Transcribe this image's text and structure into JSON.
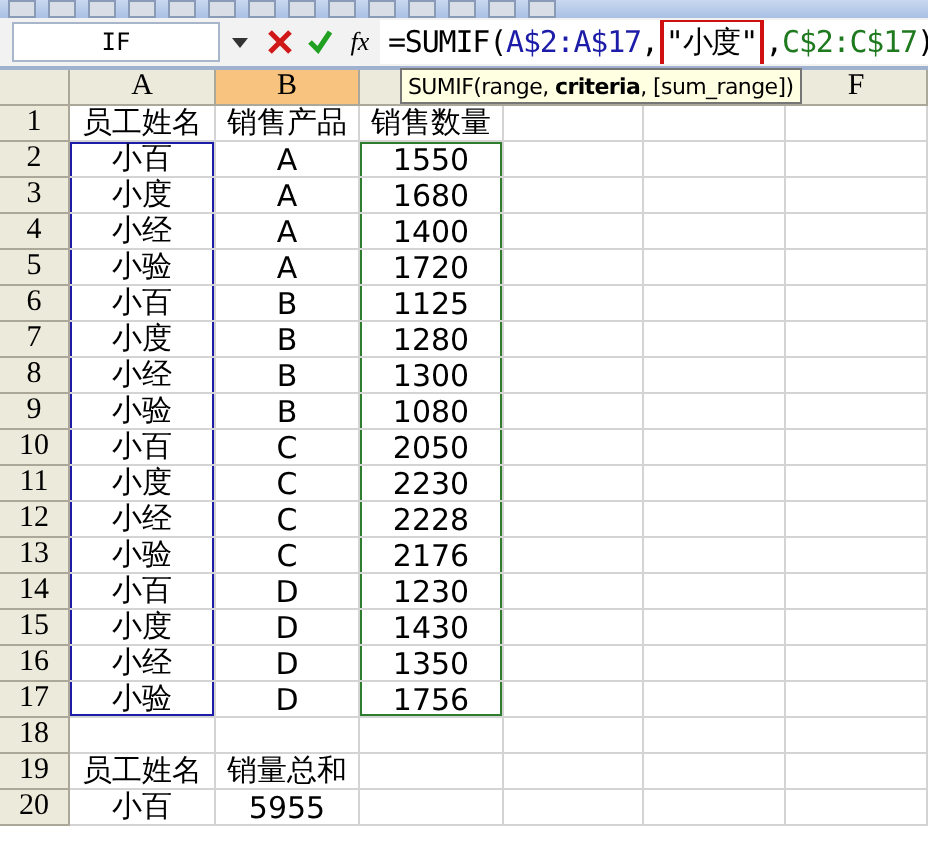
{
  "name_box": "IF",
  "formula_buttons": {
    "function_label": "fx"
  },
  "formula_parts": [
    {
      "text": "=SUMIF(",
      "kind": "plain"
    },
    {
      "text": "A$2:A$17",
      "kind": "ref",
      "color": "#1c1ca8"
    },
    {
      "text": ",",
      "kind": "plain"
    },
    {
      "text": "\"小度\"",
      "kind": "highlight"
    },
    {
      "text": ",",
      "kind": "plain"
    },
    {
      "text": "C$2:C$17",
      "kind": "ref",
      "color": "#1f7a1f"
    },
    {
      "text": ")",
      "kind": "plain"
    }
  ],
  "tooltip": "SUMIF(range, **criteria**, [sum_range])",
  "columns": [
    {
      "label": "A",
      "selected": false,
      "color": "#1c1ca8"
    },
    {
      "label": "B",
      "selected": true
    },
    {
      "selected": false,
      "color": "#2e7d2e"
    },
    {},
    {},
    {
      "label": "F",
      "selected": false
    }
  ],
  "rows": [
    {
      "number": "1",
      "in_range": false,
      "cells": [
        "员工姓名",
        "销售产品",
        "销售数量"
      ]
    },
    {
      "number": "2",
      "in_range": true,
      "cells": [
        "小百",
        "A",
        "1550"
      ]
    },
    {
      "number": "3",
      "in_range": true,
      "cells": [
        "小度",
        "A",
        "1680"
      ]
    },
    {
      "number": "4",
      "in_range": true,
      "cells": [
        "小经",
        "A",
        "1400"
      ]
    },
    {
      "number": "5",
      "in_range": true,
      "cells": [
        "小验",
        "A",
        "1720"
      ]
    },
    {
      "number": "6",
      "in_range": true,
      "cells": [
        "小百",
        "B",
        "1125"
      ]
    },
    {
      "number": "7",
      "in_range": true,
      "cells": [
        "小度",
        "B",
        "1280"
      ]
    },
    {
      "number": "8",
      "in_range": true,
      "cells": [
        "小经",
        "B",
        "1300"
      ]
    },
    {
      "number": "9",
      "in_range": true,
      "cells": [
        "小验",
        "B",
        "1080"
      ]
    },
    {
      "number": "10",
      "in_range": true,
      "cells": [
        "小百",
        "C",
        "2050"
      ]
    },
    {
      "number": "11",
      "in_range": true,
      "cells": [
        "小度",
        "C",
        "2230"
      ]
    },
    {
      "number": "12",
      "in_range": true,
      "cells": [
        "小经",
        "C",
        "2228"
      ]
    },
    {
      "number": "13",
      "in_range": true,
      "cells": [
        "小验",
        "C",
        "2176"
      ]
    },
    {
      "number": "14",
      "in_range": true,
      "cells": [
        "小百",
        "D",
        "1230"
      ]
    },
    {
      "number": "15",
      "in_range": true,
      "cells": [
        "小度",
        "D",
        "1430"
      ]
    },
    {
      "number": "16",
      "in_range": true,
      "cells": [
        "小经",
        "D",
        "1350"
      ]
    },
    {
      "number": "17",
      "in_range": true,
      "cells": [
        "小验",
        "D",
        "1756"
      ]
    },
    {
      "number": "18",
      "in_range": false,
      "cells": []
    },
    {
      "number": "19",
      "in_range": false,
      "cells": [
        "员工姓名",
        "销量总和"
      ]
    },
    {
      "number": "20",
      "in_range": false,
      "cells": [
        "小百",
        "5955"
      ]
    }
  ]
}
